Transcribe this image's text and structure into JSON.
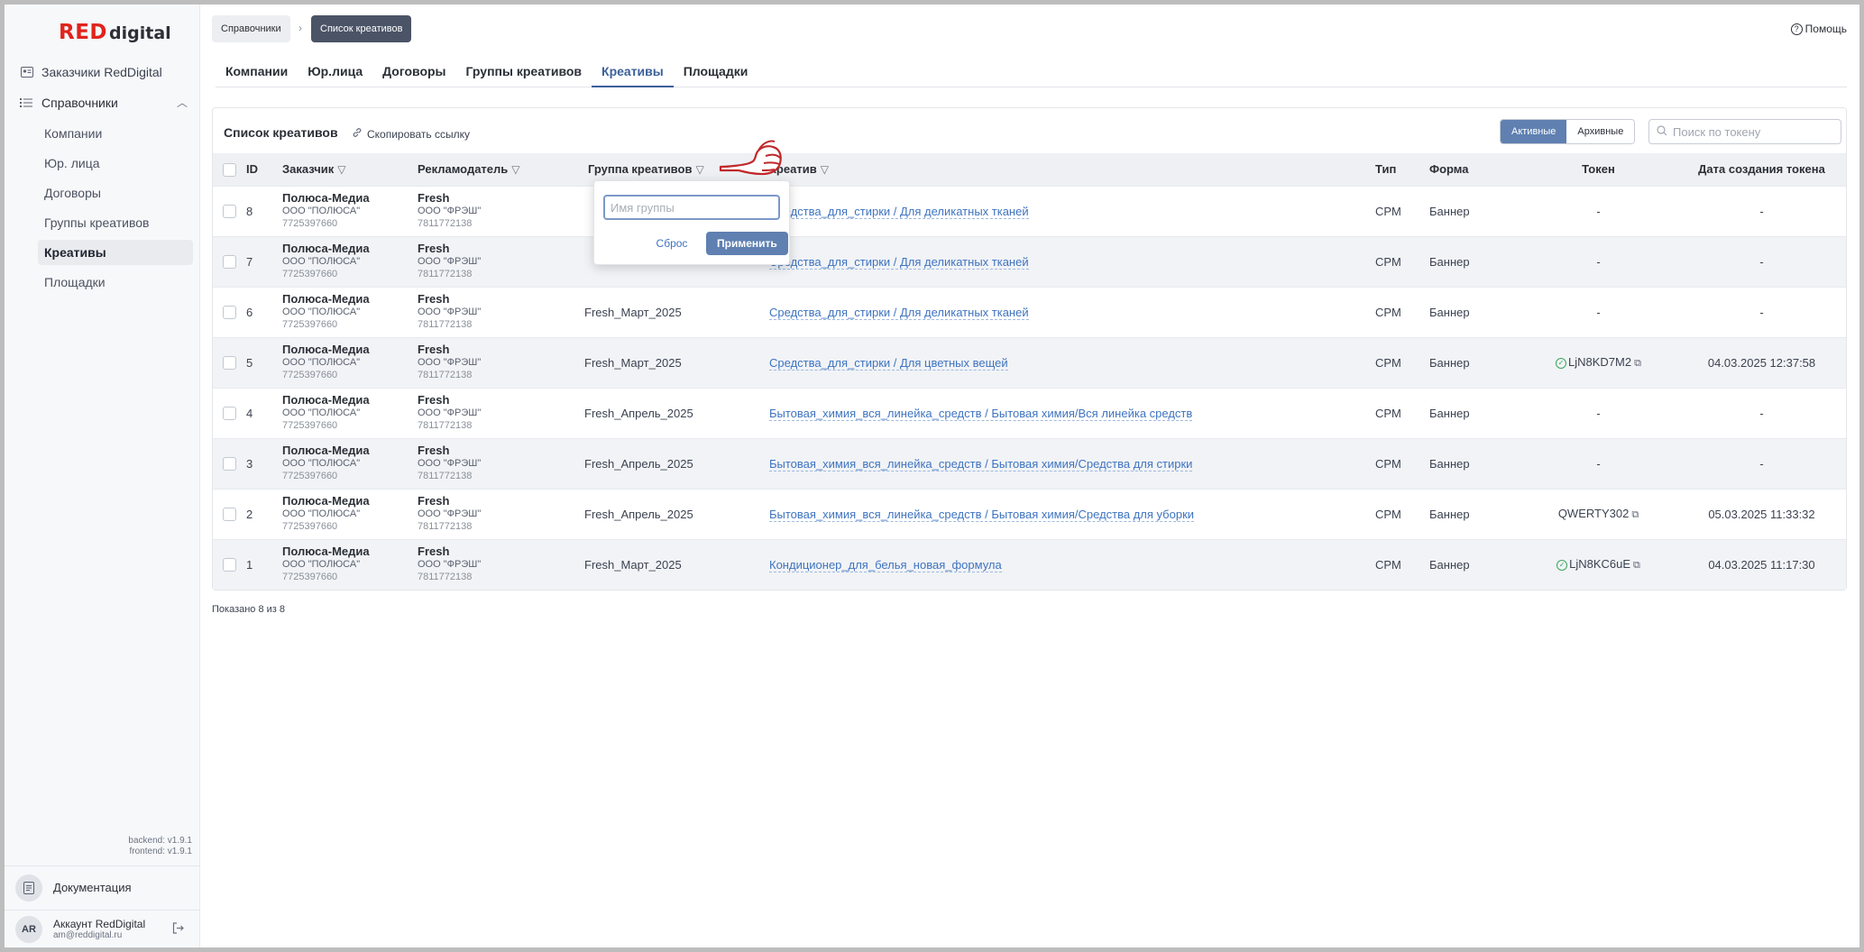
{
  "logo": {
    "red": "RED",
    "digital": "digital"
  },
  "sidebar": {
    "top_item": "Заказчики RedDigital",
    "section": "Справочники",
    "items": [
      "Компании",
      "Юр. лица",
      "Договоры",
      "Группы креативов",
      "Креативы",
      "Площадки"
    ],
    "active_item": "Креативы",
    "version_backend": "backend: v1.9.1",
    "version_frontend": "frontend: v1.9.1",
    "docs": "Документация",
    "account_initials": "AR",
    "account_name": "Аккаунт RedDigital",
    "account_email": "am@reddigital.ru"
  },
  "breadcrumb": {
    "first": "Справочники",
    "second": "Список креативов"
  },
  "help": "Помощь",
  "tabs": [
    "Компании",
    "Юр.лица",
    "Договоры",
    "Группы креативов",
    "Креативы",
    "Площадки"
  ],
  "active_tab": "Креативы",
  "card": {
    "title": "Список креативов",
    "copy_link": "Скопировать ссылку",
    "seg_active": "Активные",
    "seg_archive": "Архивные",
    "search_placeholder": "Поиск по токену"
  },
  "table": {
    "headers": {
      "id": "ID",
      "customer": "Заказчик",
      "advertiser": "Рекламодатель",
      "group": "Группа креативов",
      "creative": "Креатив",
      "type": "Тип",
      "form": "Форма",
      "token": "Токен",
      "date": "Дата создания токена"
    },
    "rows": [
      {
        "id": "8",
        "c1": "Полюса-Медиа",
        "c2": "ООО \"ПОЛЮСА\"",
        "c3": "7725397660",
        "a1": "Fresh",
        "a2": "ООО \"ФРЭШ\"",
        "a3": "7811772138",
        "group": "",
        "creative": "Средства_для_стирки / Для деликатных тканей",
        "type": "CPM",
        "form": "Баннер",
        "token": "-",
        "date": "-"
      },
      {
        "id": "7",
        "c1": "Полюса-Медиа",
        "c2": "ООО \"ПОЛЮСА\"",
        "c3": "7725397660",
        "a1": "Fresh",
        "a2": "ООО \"ФРЭШ\"",
        "a3": "7811772138",
        "group": "",
        "creative": "Средства_для_стирки / Для деликатных тканей",
        "type": "CPM",
        "form": "Баннер",
        "token": "-",
        "date": "-"
      },
      {
        "id": "6",
        "c1": "Полюса-Медиа",
        "c2": "ООО \"ПОЛЮСА\"",
        "c3": "7725397660",
        "a1": "Fresh",
        "a2": "ООО \"ФРЭШ\"",
        "a3": "7811772138",
        "group": "Fresh_Март_2025",
        "creative": "Средства_для_стирки / Для деликатных тканей",
        "type": "CPM",
        "form": "Баннер",
        "token": "-",
        "date": "-"
      },
      {
        "id": "5",
        "c1": "Полюса-Медиа",
        "c2": "ООО \"ПОЛЮСА\"",
        "c3": "7725397660",
        "a1": "Fresh",
        "a2": "ООО \"ФРЭШ\"",
        "a3": "7811772138",
        "group": "Fresh_Март_2025",
        "creative": "Средства_для_стирки / Для цветных вещей",
        "type": "CPM",
        "form": "Баннер",
        "token": "LjN8KD7M2",
        "date": "04.03.2025 12:37:58"
      },
      {
        "id": "4",
        "c1": "Полюса-Медиа",
        "c2": "ООО \"ПОЛЮСА\"",
        "c3": "7725397660",
        "a1": "Fresh",
        "a2": "ООО \"ФРЭШ\"",
        "a3": "7811772138",
        "group": "Fresh_Апрель_2025",
        "creative": "Бытовая_химия_вся_линейка_средств / Бытовая химия/Вся линейка средств",
        "type": "CPM",
        "form": "Баннер",
        "token": "-",
        "date": "-"
      },
      {
        "id": "3",
        "c1": "Полюса-Медиа",
        "c2": "ООО \"ПОЛЮСА\"",
        "c3": "7725397660",
        "a1": "Fresh",
        "a2": "ООО \"ФРЭШ\"",
        "a3": "7811772138",
        "group": "Fresh_Апрель_2025",
        "creative": "Бытовая_химия_вся_линейка_средств / Бытовая химия/Средства для стирки",
        "type": "CPM",
        "form": "Баннер",
        "token": "-",
        "date": "-"
      },
      {
        "id": "2",
        "c1": "Полюса-Медиа",
        "c2": "ООО \"ПОЛЮСА\"",
        "c3": "7725397660",
        "a1": "Fresh",
        "a2": "ООО \"ФРЭШ\"",
        "a3": "7811772138",
        "group": "Fresh_Апрель_2025",
        "creative": "Бытовая_химия_вся_линейка_средств / Бытовая химия/Средства для уборки",
        "type": "CPM",
        "form": "Баннер",
        "token": "QWERTY302",
        "date": "05.03.2025 11:33:32"
      },
      {
        "id": "1",
        "c1": "Полюса-Медиа",
        "c2": "ООО \"ПОЛЮСА\"",
        "c3": "7725397660",
        "a1": "Fresh",
        "a2": "ООО \"ФРЭШ\"",
        "a3": "7811772138",
        "group": "Fresh_Март_2025",
        "creative": "Кондиционер_для_белья_новая_формула",
        "type": "CPM",
        "form": "Баннер",
        "token": "LjN8KC6uE",
        "date": "04.03.2025 11:17:30"
      }
    ]
  },
  "footer": "Показано 8 из 8",
  "popover": {
    "placeholder": "Имя группы",
    "reset": "Сброс",
    "apply": "Применить"
  },
  "colors": {
    "accent": "#5f80b1",
    "link": "#3f74c0",
    "brand_red": "#e0241c",
    "ok_green": "#3aa65a"
  }
}
